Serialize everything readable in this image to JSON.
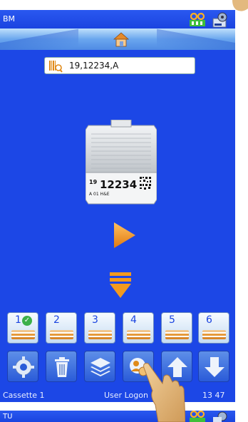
{
  "status_bar": {
    "user": "BM"
  },
  "barcode": {
    "value": "19,12234,A"
  },
  "cassette": {
    "label_top_num": "19",
    "label_big": "12234",
    "label_bottom": "A  01  H&E"
  },
  "slots": [
    {
      "label": "1",
      "selected": true
    },
    {
      "label": "2",
      "selected": false
    },
    {
      "label": "3",
      "selected": false
    },
    {
      "label": "4",
      "selected": false
    },
    {
      "label": "5",
      "selected": false
    },
    {
      "label": "6",
      "selected": false
    }
  ],
  "footer": {
    "left": "Cassette 1",
    "center": "User Logon",
    "right": "13 47"
  },
  "second_screen": {
    "user": "TU"
  },
  "colors": {
    "screen_bg": "#1c47e6",
    "accent_orange": "#f39a1e"
  }
}
